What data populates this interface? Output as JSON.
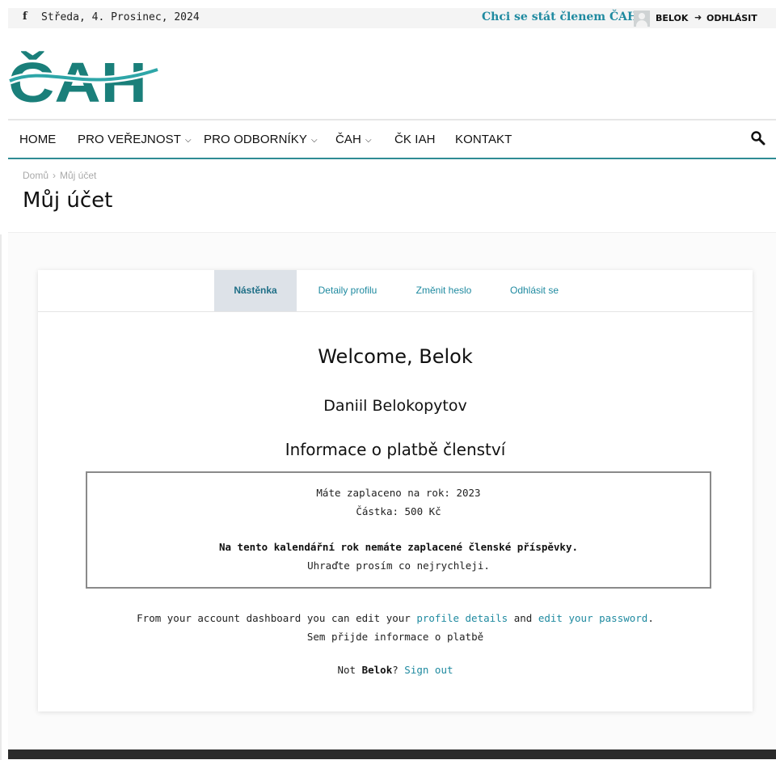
{
  "topbar": {
    "facebook_icon": "f",
    "date": "Středa, 4. Prosinec, 2024",
    "become_member": "Chci se stát členem ČAH",
    "username": "BELOK",
    "logout_icon": "➜",
    "logout": "ODHLÁSIT"
  },
  "logo": {
    "text": "ČAH",
    "color": "#1a7f7a",
    "wave_color": "#2ea6a8"
  },
  "menu": {
    "items": [
      {
        "label": "HOME"
      },
      {
        "label": "PRO VEŘEJNOST",
        "dropdown": "⌄"
      },
      {
        "label": "PRO ODBORNÍKY",
        "dropdown": "⌄"
      },
      {
        "label": "ČAH",
        "dropdown": "⌄"
      },
      {
        "label": "ČK IAH"
      },
      {
        "label": "KONTAKT"
      }
    ],
    "search_icon": "search-icon",
    "accent_color": "#2f8c94"
  },
  "breadcrumb": {
    "home": "Domů",
    "separator": "›",
    "current": "Můj účet"
  },
  "page_title": "Můj účet",
  "account": {
    "tabs": [
      {
        "label": "Nástěnka",
        "active": true
      },
      {
        "label": "Detaily profilu",
        "active": false
      },
      {
        "label": "Změnit heslo",
        "active": false
      },
      {
        "label": "Odhlásit se",
        "active": false
      }
    ],
    "welcome": "Welcome, Belok",
    "full_name": "Daniil Belokopytov",
    "payment_heading": "Informace o platbě členství",
    "payment": {
      "paid_for_year": "Máte zaplaceno na rok: 2023",
      "amount": "Částka: 500 Kč",
      "warning": "Na tento kalendářní rok nemáte zaplacené členské příspěvky.",
      "request": "Uhraďte prosím co nejrychleji."
    },
    "dashboard": {
      "text_before": "From your account dashboard you can edit your ",
      "profile_link": "profile details",
      "text_and": " and ",
      "password_link": "edit your password",
      "text_end": ".",
      "payment_note": "Sem přijde informace o platbě"
    },
    "not_user": {
      "prefix": "Not ",
      "name": "Belok",
      "suffix": "? ",
      "sign_out": "Sign out"
    }
  },
  "colors": {
    "link": "#1f8aa0",
    "active_tab_bg": "#dde2e8",
    "topbar_bg": "#f4f4f4"
  }
}
